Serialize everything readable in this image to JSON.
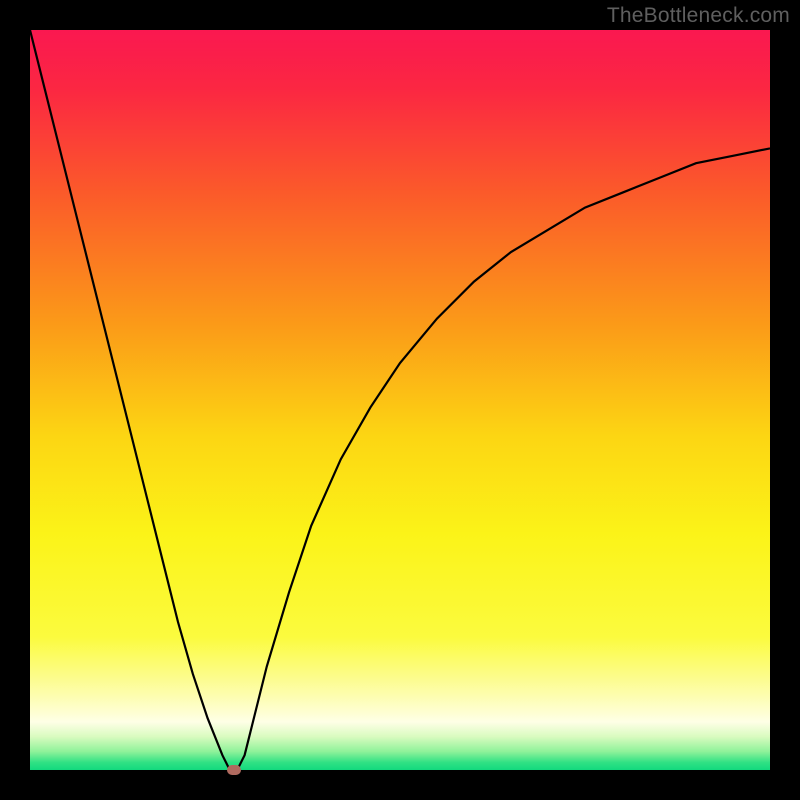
{
  "attribution": "TheBottleneck.com",
  "chart_data": {
    "type": "line",
    "title": "",
    "xlabel": "",
    "ylabel": "",
    "xlim": [
      0,
      100
    ],
    "ylim": [
      0,
      100
    ],
    "gradient_stops": [
      {
        "offset": 0,
        "color": "#fa1850"
      },
      {
        "offset": 0.08,
        "color": "#fb2742"
      },
      {
        "offset": 0.22,
        "color": "#fb5a2a"
      },
      {
        "offset": 0.4,
        "color": "#fb9b18"
      },
      {
        "offset": 0.55,
        "color": "#fcd613"
      },
      {
        "offset": 0.68,
        "color": "#fbf318"
      },
      {
        "offset": 0.82,
        "color": "#fbfb3e"
      },
      {
        "offset": 0.9,
        "color": "#fdfdb0"
      },
      {
        "offset": 0.935,
        "color": "#feffe6"
      },
      {
        "offset": 0.955,
        "color": "#d9fbbf"
      },
      {
        "offset": 0.975,
        "color": "#8ff29a"
      },
      {
        "offset": 0.99,
        "color": "#2fe184"
      },
      {
        "offset": 1.0,
        "color": "#12d97e"
      }
    ],
    "series": [
      {
        "name": "bottleneck-curve",
        "x": [
          0,
          2,
          4,
          6,
          8,
          10,
          12,
          14,
          16,
          18,
          20,
          22,
          24,
          26,
          27,
          28,
          29,
          30,
          32,
          35,
          38,
          42,
          46,
          50,
          55,
          60,
          65,
          70,
          75,
          80,
          85,
          90,
          95,
          100
        ],
        "y": [
          100,
          92,
          84,
          76,
          68,
          60,
          52,
          44,
          36,
          28,
          20,
          13,
          7,
          2,
          0,
          0,
          2,
          6,
          14,
          24,
          33,
          42,
          49,
          55,
          61,
          66,
          70,
          73,
          76,
          78,
          80,
          82,
          83,
          84
        ]
      }
    ],
    "minimum_point": {
      "x": 27.5,
      "y": 0,
      "color": "#b06a5f"
    }
  }
}
